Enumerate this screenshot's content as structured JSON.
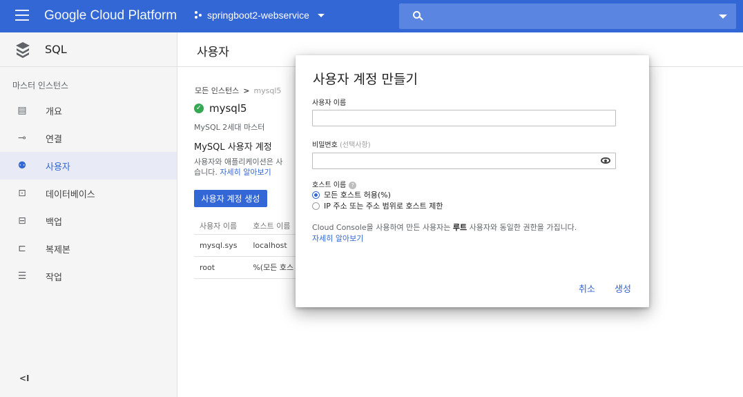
{
  "topbar": {
    "brand": "Google Cloud Platform",
    "project": "springboot2-webservice",
    "color": "#3367d6"
  },
  "sidebar": {
    "product": "SQL",
    "section_label": "마스터 인스턴스",
    "items": [
      {
        "label": "개요",
        "icon": "overview-icon"
      },
      {
        "label": "연결",
        "icon": "connection-icon"
      },
      {
        "label": "사용자",
        "icon": "users-icon",
        "active": true
      },
      {
        "label": "데이터베이스",
        "icon": "database-icon"
      },
      {
        "label": "백업",
        "icon": "backup-icon"
      },
      {
        "label": "복제본",
        "icon": "replica-icon"
      },
      {
        "label": "작업",
        "icon": "operations-icon"
      }
    ],
    "collapse": "<I"
  },
  "main": {
    "title": "사용자",
    "breadcrumb": {
      "root": "모든 인스턴스",
      "sep": ">",
      "current": "mysql5"
    },
    "instance_name": "mysql5",
    "instance_sub": "MySQL 2세대 마스터",
    "section_title": "MySQL 사용자 계정",
    "desc_line1": "사용자와 애플리케이션은 사",
    "desc_line2": "습니다.",
    "desc_link": "자세히 알아보기",
    "create_button": "사용자 계정 생성",
    "table": {
      "headers": [
        "사용자 이름",
        "호스트 이름"
      ],
      "rows": [
        [
          "mysql.sys",
          "localhost"
        ],
        [
          "root",
          "%(모든 호스"
        ]
      ]
    }
  },
  "dialog": {
    "title": "사용자 계정 만들기",
    "username_label": "사용자 이름",
    "username_value": "",
    "password_label": "비밀번호",
    "password_optional": "(선택사항)",
    "password_value": "",
    "host_label": "호스트 이름",
    "host_options": [
      "모든 호스트 허용(%)",
      "IP 주소 또는 주소 범위로 호스트 제한"
    ],
    "host_selected": 0,
    "note_pre": "Cloud Console을 사용하여 만든 사용자는 ",
    "note_bold": "루트",
    "note_post": " 사용자와 동일한 권한을 가집니다.",
    "note_link": "자세히 알아보기",
    "cancel": "취소",
    "create": "생성"
  }
}
